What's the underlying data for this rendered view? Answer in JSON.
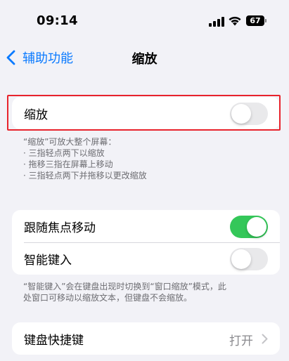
{
  "status_bar": {
    "time": "09:14",
    "battery": "67"
  },
  "nav": {
    "back_label": "辅助功能",
    "title": "缩放"
  },
  "zoom_section": {
    "label": "缩放",
    "toggle": "off"
  },
  "zoom_footnote": {
    "title": "“缩放”可放大整个屏幕：",
    "items": [
      "三指轻点两下以缩放",
      "拖移三指在屏幕上移动",
      "三指轻点两下并拖移以更改缩放"
    ]
  },
  "focus_section": {
    "follow_focus_label": "跟随焦点移动",
    "follow_focus_toggle": "on",
    "smart_typing_label": "智能键入",
    "smart_typing_toggle": "off"
  },
  "smart_typing_footnote": {
    "line1": "“智能键入”会在键盘出现时切换到“窗口缩放”模式，此",
    "line2": "处窗口可移动以缩放文本，但键盘不会缩放。"
  },
  "keyboard_section": {
    "label": "键盘快捷键",
    "value": "打开"
  },
  "colors": {
    "accent": "#0a7aff",
    "toggle_on": "#34c759",
    "highlight": "#e8232c"
  }
}
